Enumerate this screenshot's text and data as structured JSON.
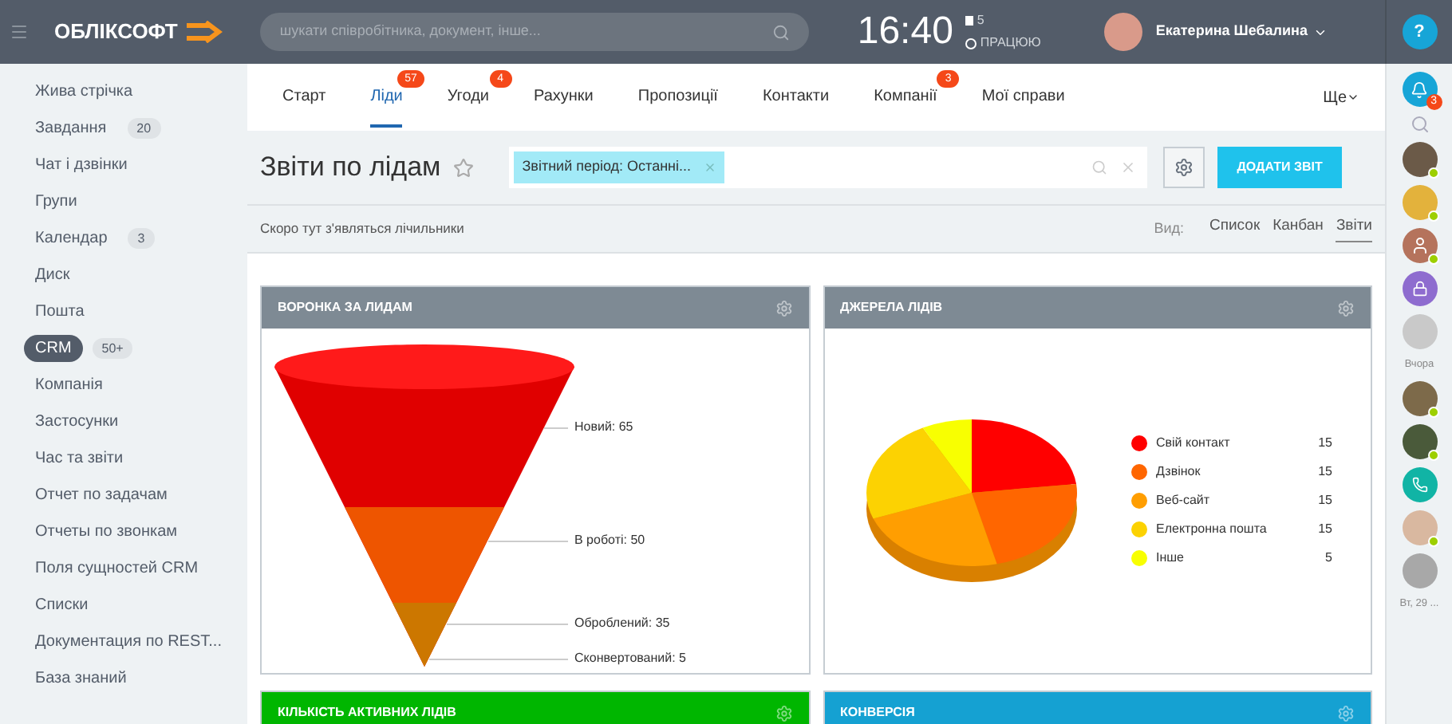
{
  "header": {
    "logo": "ОБЛІКСОФТ",
    "search_placeholder": "шукати співробітника, документ, інше...",
    "time": "16:40",
    "flag_count": "5",
    "status": "ПРАЦЮЮ",
    "user_name": "Екатерина Шебалина",
    "help": "?"
  },
  "sidebar": {
    "items": [
      {
        "label": "Жива стрічка",
        "selected": false
      },
      {
        "label": "Завдання",
        "counter": "20",
        "selected": false
      },
      {
        "label": "Чат і дзвінки",
        "selected": false
      },
      {
        "label": "Групи",
        "selected": false
      },
      {
        "label": "Календар",
        "counter": "3",
        "selected": false
      },
      {
        "label": "Диск",
        "selected": false
      },
      {
        "label": "Пошта",
        "selected": false
      },
      {
        "label": "CRM",
        "counter": "50+",
        "selected": true
      },
      {
        "label": "Компанія",
        "selected": false
      },
      {
        "label": "Застосунки",
        "selected": false
      },
      {
        "label": "Час та звіти",
        "selected": false
      },
      {
        "label": "Отчет по задачам",
        "selected": false
      },
      {
        "label": "Отчеты по звонкам",
        "selected": false
      },
      {
        "label": "Поля сущностей CRM",
        "selected": false
      },
      {
        "label": "Списки",
        "selected": false
      },
      {
        "label": "Документация по REST...",
        "selected": false
      },
      {
        "label": "База знаний",
        "selected": false
      }
    ]
  },
  "tabs": [
    {
      "label": "Старт",
      "selected": false
    },
    {
      "label": "Ліди",
      "counter": "57",
      "selected": true
    },
    {
      "label": "Угоди",
      "counter": "4",
      "selected": false
    },
    {
      "label": "Рахунки",
      "selected": false
    },
    {
      "label": "Пропозиції",
      "selected": false
    },
    {
      "label": "Контакти",
      "selected": false
    },
    {
      "label": "Компанії",
      "counter": "3",
      "selected": false
    },
    {
      "label": "Мої справи",
      "selected": false
    }
  ],
  "more_tab": "Ще",
  "page_title": "Звіти по лідам",
  "filter_tag": "Звітний період: Останні...",
  "add_button": "ДОДАТИ ЗВІТ",
  "counters_note": "Скоро тут з'являться лічильники",
  "view": {
    "label": "Вид:",
    "options": [
      {
        "label": "Список",
        "selected": false
      },
      {
        "label": "Канбан",
        "selected": false
      },
      {
        "label": "Звіти",
        "selected": true
      }
    ]
  },
  "widgets": [
    {
      "title": "ВОРОНКА ЗА ЛИДАМ",
      "color": "#7e8a94",
      "kind": "funnel",
      "labels": [
        "Новий: 65",
        "В роботі: 50",
        "Оброблений: 35",
        "Сконвертований: 5"
      ]
    },
    {
      "title": "ДЖЕРЕЛА ЛІДІВ",
      "color": "#7e8a94",
      "kind": "pie",
      "legend": [
        {
          "label": "Свій контакт",
          "value": "15",
          "color": "#ff0000"
        },
        {
          "label": "Дзвінок",
          "value": "15",
          "color": "#ff6600"
        },
        {
          "label": "Веб-сайт",
          "value": "15",
          "color": "#ff9e01"
        },
        {
          "label": "Електронна пошта",
          "value": "15",
          "color": "#fcd202"
        },
        {
          "label": "Інше",
          "value": "5",
          "color": "#f8ff01"
        }
      ]
    },
    {
      "title": "КІЛЬКІСТЬ АКТИВНИХ ЛІДІВ",
      "color": "#00b600",
      "kind": "empty"
    },
    {
      "title": "КОНВЕРСІЯ",
      "color": "#15a1d2",
      "kind": "empty"
    }
  ],
  "right_bar": {
    "notification_count": "3",
    "contacts": [
      {
        "kind": "avatar",
        "online": true,
        "color": "#6b5a48"
      },
      {
        "kind": "avatar",
        "online": true,
        "color": "#e3b23c"
      },
      {
        "kind": "person",
        "online": true,
        "color": "#b5735c"
      },
      {
        "kind": "lock",
        "online": false,
        "color": "#8e6ccf"
      },
      {
        "kind": "avatar",
        "online": false,
        "color": "#c9c9c9"
      },
      {
        "kind": "date",
        "label": "Вчора"
      },
      {
        "kind": "avatar",
        "online": true,
        "color": "#7d6a4a"
      },
      {
        "kind": "avatar",
        "online": true,
        "color": "#4a5a3a"
      },
      {
        "kind": "phone",
        "online": false,
        "color": "#11b4a5"
      },
      {
        "kind": "avatar",
        "online": true,
        "color": "#d9b8a0"
      },
      {
        "kind": "avatar",
        "online": false,
        "color": "#a8a8a8"
      },
      {
        "kind": "date",
        "label": "Вт, 29 ..."
      }
    ]
  }
}
